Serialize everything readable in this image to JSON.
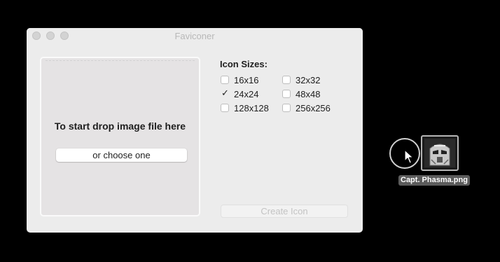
{
  "window": {
    "title": "Faviconer"
  },
  "dropzone": {
    "prompt": "To start drop image file here",
    "choose_label": "or choose one"
  },
  "sizes": {
    "title": "Icon Sizes:",
    "options": [
      {
        "label": "16x16",
        "checked": false
      },
      {
        "label": "32x32",
        "checked": false
      },
      {
        "label": "24x24",
        "checked": true
      },
      {
        "label": "48x48",
        "checked": false
      },
      {
        "label": "128x128",
        "checked": false
      },
      {
        "label": "256x256",
        "checked": false
      }
    ]
  },
  "create_button": {
    "label": "Create Icon",
    "enabled": false
  },
  "drag": {
    "file_name": "Capt. Phasma.png",
    "icon": "image-thumbnail-icon"
  }
}
